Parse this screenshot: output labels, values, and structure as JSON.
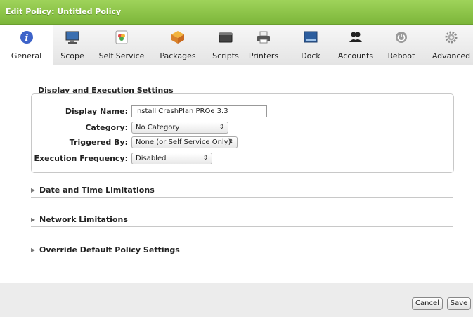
{
  "window": {
    "title": "Edit Policy: Untitled Policy"
  },
  "tabs": [
    {
      "label": "General",
      "icon": "info-icon",
      "active": true
    },
    {
      "label": "Scope",
      "icon": "monitor-icon"
    },
    {
      "label": "Self Service",
      "icon": "self-service-icon"
    },
    {
      "label": "Packages",
      "icon": "package-icon"
    },
    {
      "label": "Scripts",
      "icon": "script-icon"
    },
    {
      "label": "Printers",
      "icon": "printer-icon"
    },
    {
      "label": "Dock",
      "icon": "dock-icon"
    },
    {
      "label": "Accounts",
      "icon": "accounts-icon"
    },
    {
      "label": "Reboot",
      "icon": "power-icon"
    },
    {
      "label": "Advanced",
      "icon": "gear-icon"
    }
  ],
  "display_section": {
    "title": "Display and Execution Settings",
    "display_name_label": "Display Name:",
    "display_name_value": "Install CrashPlan PROe 3.3",
    "category_label": "Category:",
    "category_value": "No Category",
    "triggered_by_label": "Triggered By:",
    "triggered_by_value": "None (or Self Service Only)",
    "execution_frequency_label": "Execution Frequency:",
    "execution_frequency_value": "Disabled"
  },
  "collapsed_sections": [
    "Date and Time Limitations",
    "Network Limitations",
    "Override Default Policy Settings"
  ],
  "footer": {
    "cancel_label": "Cancel",
    "save_label": "Save"
  },
  "colors": {
    "titlebar": "#8cc447",
    "accent_info": "#3d63c9"
  }
}
